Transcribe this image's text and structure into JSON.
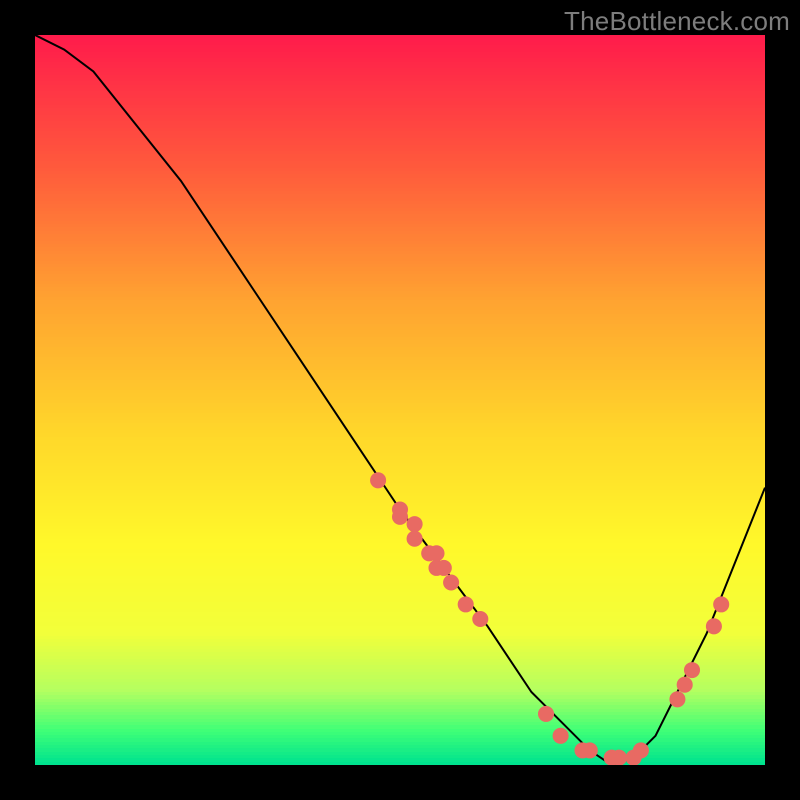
{
  "attribution": "TheBottleneck.com",
  "colors": {
    "background": "#000000",
    "curve": "#000000",
    "dot": "#e86a63",
    "gradient_stops": [
      "#ff1c4b",
      "#ff5a3c",
      "#ffa231",
      "#ffd82a",
      "#fff82a",
      "#f2ff3a",
      "#b4ff60",
      "#3fff77",
      "#00e38e"
    ]
  },
  "chart_data": {
    "type": "line",
    "title": "",
    "xlabel": "",
    "ylabel": "",
    "xlim": [
      0,
      100
    ],
    "ylim": [
      0,
      100
    ],
    "x": [
      0,
      4,
      8,
      12,
      20,
      28,
      36,
      44,
      50,
      56,
      62,
      68,
      72,
      76,
      79,
      82,
      85,
      88,
      92,
      96,
      100
    ],
    "values": [
      100,
      98,
      95,
      90,
      80,
      68,
      56,
      44,
      35,
      27,
      19,
      10,
      6,
      2,
      0,
      1,
      4,
      10,
      18,
      28,
      38
    ],
    "dots": {
      "x": [
        47,
        50,
        50,
        52,
        52,
        54,
        55,
        55,
        56,
        57,
        59,
        61,
        70,
        72,
        75,
        76,
        79,
        80,
        82,
        83,
        88,
        89,
        90,
        93,
        94
      ],
      "y": [
        39,
        35,
        34,
        31,
        33,
        29,
        27,
        29,
        27,
        25,
        22,
        20,
        7,
        4,
        2,
        2,
        1,
        1,
        1,
        2,
        9,
        11,
        13,
        19,
        22
      ]
    }
  }
}
